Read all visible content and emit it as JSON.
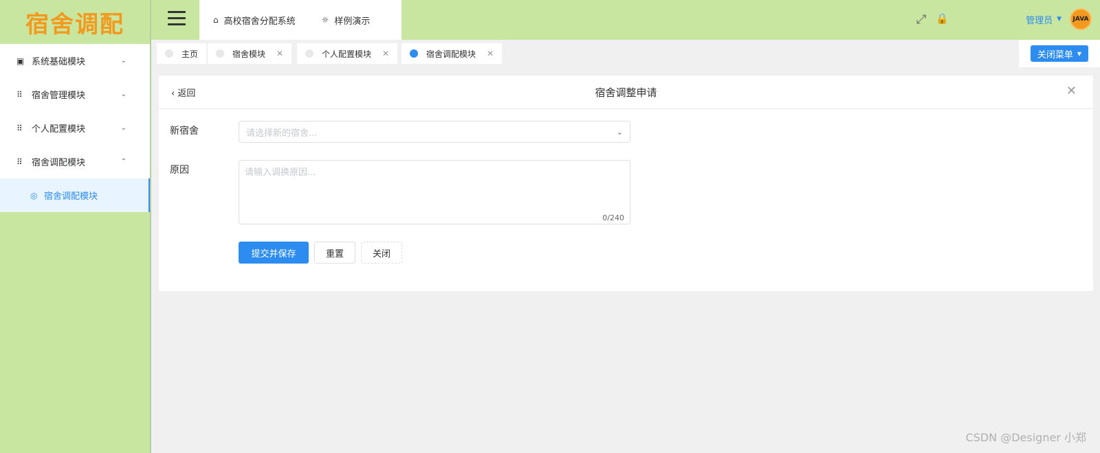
{
  "app": {
    "logo_text": "宿舍调配"
  },
  "sidebar": {
    "items": [
      {
        "icon": "chart-icon",
        "glyph": "▣",
        "label": "系统基础模块",
        "arrow": "⌄"
      },
      {
        "icon": "grid-icon",
        "glyph": "⠿",
        "label": "宿舍管理模块",
        "arrow": "⌄"
      },
      {
        "icon": "grid-icon",
        "glyph": "⠿",
        "label": "个人配置模块",
        "arrow": "⌄"
      },
      {
        "icon": "grid-icon",
        "glyph": "⠿",
        "label": "宿舍调配模块",
        "arrow": "⌃"
      }
    ],
    "active_sub": {
      "icon": "circle-icon",
      "glyph": "◎",
      "label": "宿舍调配模块"
    }
  },
  "header": {
    "nav": [
      {
        "icon": "home-icon",
        "glyph": "⌂",
        "label": "高校宿舍分配系统"
      },
      {
        "icon": "bulb-icon",
        "glyph": "☼",
        "label": "样例演示"
      }
    ],
    "tools": {
      "fullscreen_glyph": "⤢",
      "lock_glyph": "🔒"
    },
    "user": {
      "name": "管理员",
      "caret": "▼",
      "avatar_text": "JAVA"
    }
  },
  "tabs": [
    {
      "label": "主页",
      "closable": false,
      "active": false
    },
    {
      "label": "宿舍模块",
      "closable": true,
      "active": false
    },
    {
      "label": "个人配置模块",
      "closable": true,
      "active": false
    },
    {
      "label": "宿舍调配模块",
      "closable": true,
      "active": true
    }
  ],
  "tabs_close_x": "✕",
  "close_menu": {
    "label": "关闭菜单",
    "caret": "▼"
  },
  "form": {
    "back_label": "返回",
    "title": "宿舍调整申请",
    "close_glyph": "✕",
    "new_dorm_label": "新宿舍",
    "new_dorm_placeholder": "请选择新的宿舍...",
    "select_chevron": "⌄",
    "reason_label": "原因",
    "reason_placeholder": "请输入调换原因...",
    "reason_count": "0/240",
    "submit_label": "提交并保存",
    "reset_label": "重置",
    "close_label": "关闭"
  },
  "watermark": "CSDN @Designer 小郑"
}
